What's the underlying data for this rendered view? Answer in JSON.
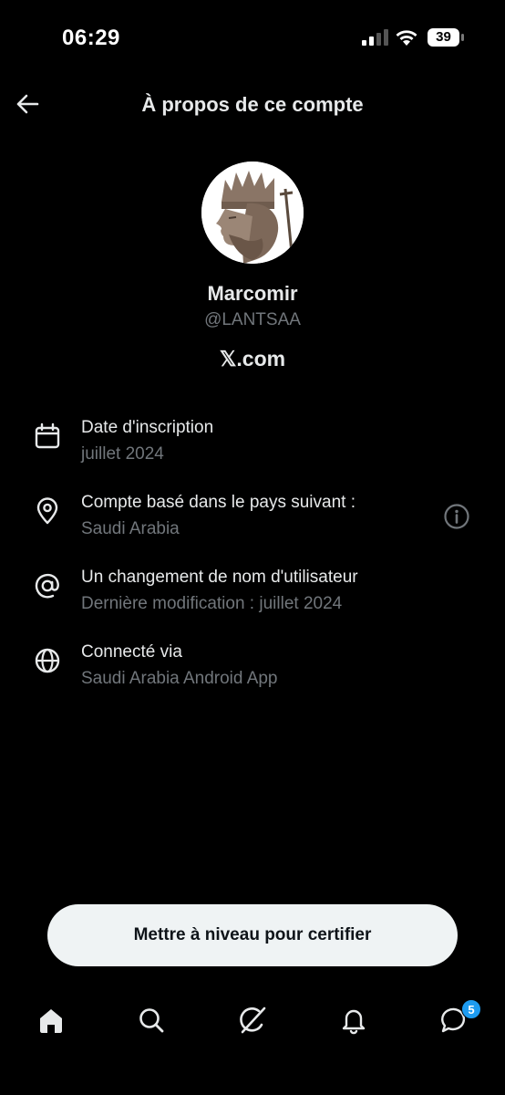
{
  "status_bar": {
    "time": "06:29",
    "battery": "39"
  },
  "header": {
    "title": "À propos de ce compte",
    "back_icon": "arrow-left-icon"
  },
  "profile": {
    "name": "Marcomir",
    "handle": "@LANTSAA",
    "site": "𝕏.com"
  },
  "info_rows": [
    {
      "icon": "calendar-icon",
      "title": "Date d'inscription",
      "subtitle": "juillet 2024"
    },
    {
      "icon": "location-pin-icon",
      "title": "Compte basé dans le pays suivant :",
      "subtitle": "Saudi Arabia",
      "action_icon": "info-icon"
    },
    {
      "icon": "at-sign-icon",
      "title": "Un changement de nom d'utilisateur",
      "subtitle": "Dernière modification : juillet 2024"
    },
    {
      "icon": "globe-icon",
      "title": "Connecté via",
      "subtitle": "Saudi Arabia Android App"
    }
  ],
  "upgrade_button": {
    "label": "Mettre à niveau pour certifier"
  },
  "bottom_nav": {
    "items": [
      "home-icon",
      "search-icon",
      "grok-icon",
      "notifications-bell-icon",
      "messages-icon"
    ],
    "messages_badge": "5"
  },
  "colors": {
    "background": "#000000",
    "primary_text": "#e7e9ea",
    "secondary_text": "#71767b",
    "accent": "#1d9bf0",
    "button_bg": "#eff3f4"
  }
}
